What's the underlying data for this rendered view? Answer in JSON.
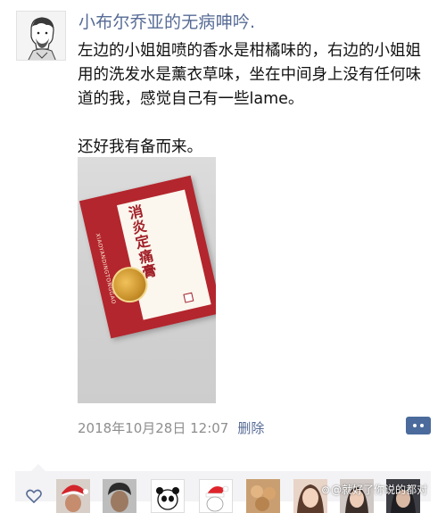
{
  "post": {
    "author": "小布尔乔亚的无病呻吟.",
    "text": "左边的小姐姐喷的香水是柑橘味的，右边的小姐姐用的洗发水是薰衣草味，坐在中间身上没有任何味道的我，感觉自己有一些lame。\n\n还好我有备而来。",
    "timestamp": "2018年10月28日 12:07",
    "delete_label": "删除",
    "photo": {
      "product_name": "消炎定痛膏",
      "product_pinyin": "XIAOYANDINGTONGGAO"
    }
  },
  "watermark": {
    "icon": "weibo-icon",
    "text": "@就好了你说的都对"
  },
  "icons": {
    "comment": "more-dots-icon",
    "like": "heart-icon"
  },
  "colors": {
    "author_link": "#576b95",
    "comment_button": "#4a6b9c",
    "likes_background": "#f3f3f5"
  }
}
